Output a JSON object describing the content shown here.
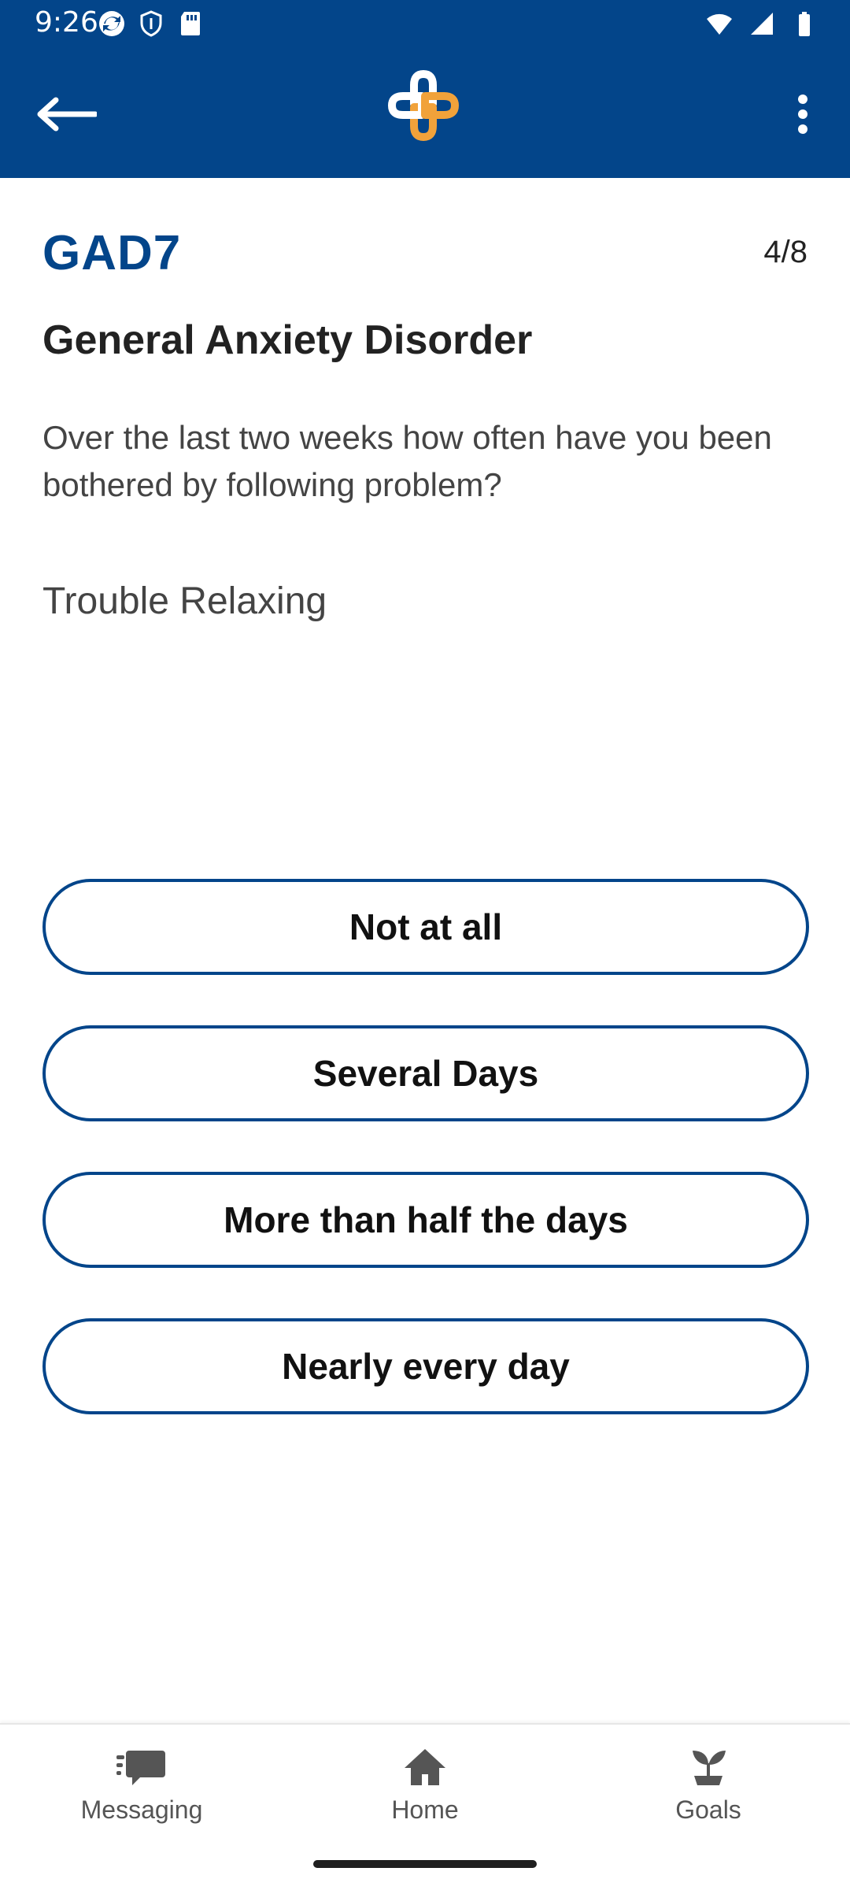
{
  "status_bar": {
    "time": "9:26"
  },
  "app_bar": {
    "back_icon": "arrow-left-icon",
    "logo_icon": "plus-cross-logo",
    "more_icon": "more-vertical-icon",
    "colors": {
      "primary": "#03458a",
      "accent": "#f1a23a"
    }
  },
  "survey": {
    "code": "GAD7",
    "progress": "4/8",
    "title": "General Anxiety Disorder",
    "prompt": "Over the last two weeks how often have you been bothered by following problem?",
    "item": "Trouble Relaxing"
  },
  "options": [
    {
      "label": "Not at all"
    },
    {
      "label": "Several Days"
    },
    {
      "label": "More than half the days"
    },
    {
      "label": "Nearly every day"
    }
  ],
  "bottom_nav": {
    "items": [
      {
        "label": "Messaging",
        "icon": "messaging-icon"
      },
      {
        "label": "Home",
        "icon": "home-icon"
      },
      {
        "label": "Goals",
        "icon": "sprout-icon"
      }
    ]
  }
}
